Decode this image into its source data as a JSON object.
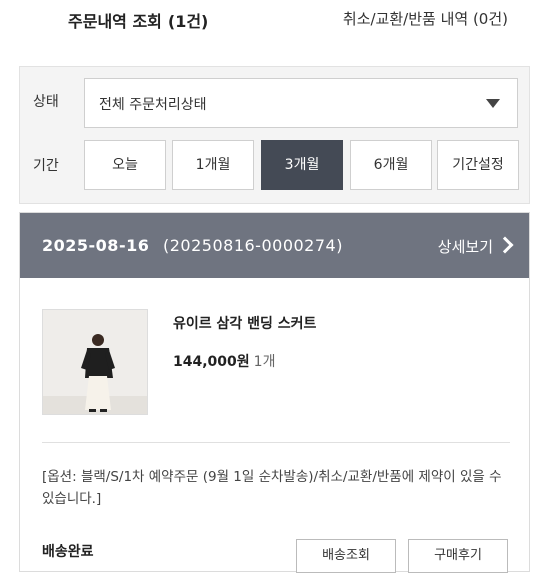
{
  "header": {
    "title": "주문내역 조회",
    "count": "(1건)",
    "cancel_link": "취소/교환/반품 내역 (0건)"
  },
  "filter": {
    "status_label": "상태",
    "status_value": "전체 주문처리상태",
    "period_label": "기간",
    "period_buttons": [
      "오늘",
      "1개월",
      "3개월",
      "6개월",
      "기간설정"
    ],
    "active_period": "3개월"
  },
  "order": {
    "date": "2025-08-16",
    "number": "(20250816-0000274)",
    "detail_link": "상세보기",
    "product_name": "유이르 삼각 밴딩 스커트",
    "price": "144,000원",
    "quantity": "1개",
    "option_note": "[옵션: 블랙/S/1차 예약주문 (9월 1일 순차발송)/취소/교환/반품에 제약이 있을 수 있습니다.]",
    "status": "배송완료",
    "buttons": [
      "배송조회",
      "구매후기"
    ]
  },
  "colors": {
    "order_header_bg": "#6f7480",
    "active_button_bg": "#444a55"
  }
}
